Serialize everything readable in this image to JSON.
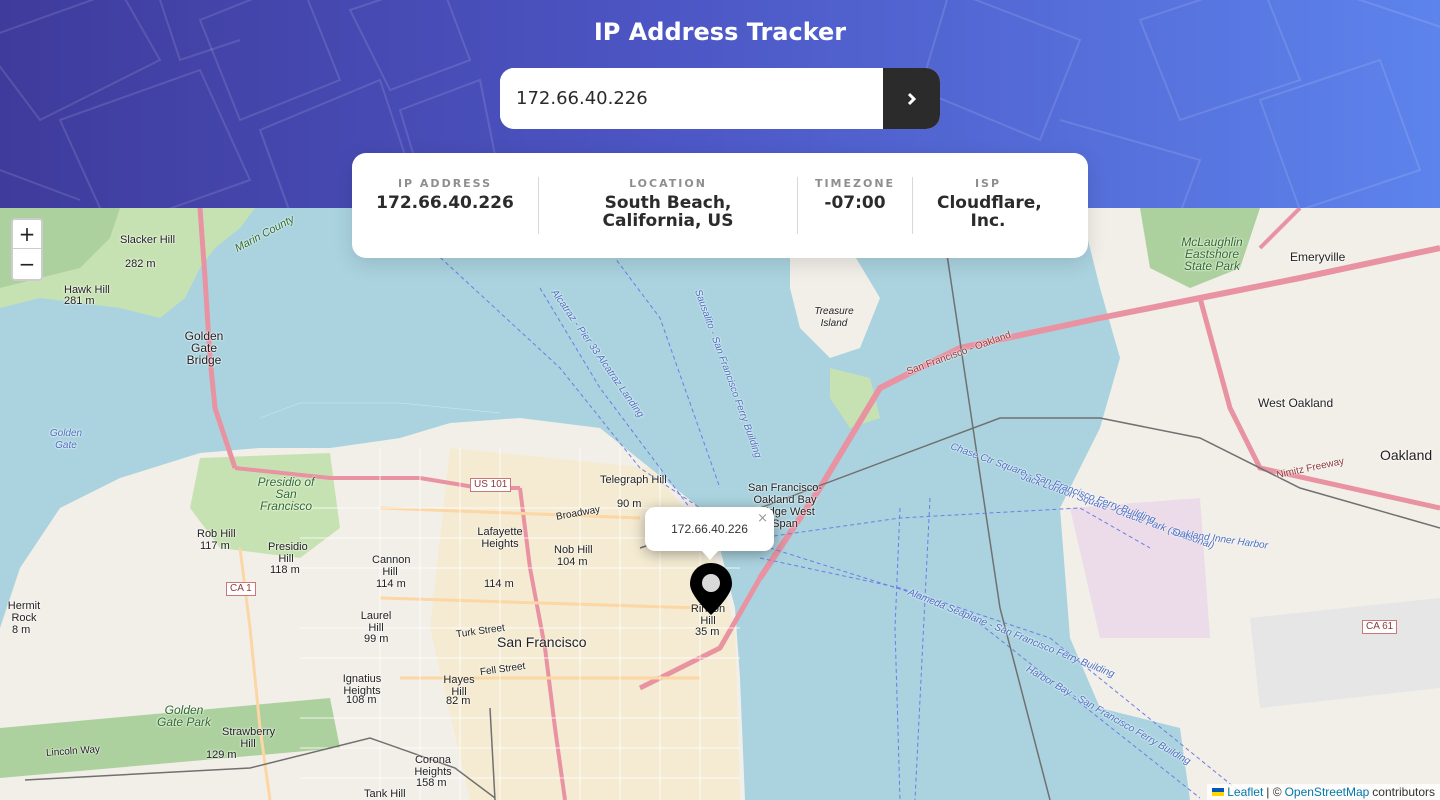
{
  "header": {
    "title": "IP Address Tracker",
    "search_value": "172.66.40.226",
    "search_button_icon": "chevron-right-icon"
  },
  "info": {
    "ip": {
      "label": "IP ADDRESS",
      "value": "172.66.40.226"
    },
    "location": {
      "label": "LOCATION",
      "value": "South Beach, California, US"
    },
    "timezone": {
      "label": "TIMEZONE",
      "value": "-07:00"
    },
    "isp": {
      "label": "ISP",
      "value": "Cloudflare, Inc."
    }
  },
  "map": {
    "zoom_in": "+",
    "zoom_out": "−",
    "popup_text": "172.66.40.226",
    "popup_close": "×",
    "attribution": {
      "leaflet": "Leaflet",
      "sep": "| ©",
      "osm": "OpenStreetMap",
      "suffix": "contributors"
    },
    "labels": {
      "marin_county": "Marin County",
      "slacker_hill": "Slacker Hill",
      "slacker_elev": "282 m",
      "hawk_hill": "Hawk Hill",
      "hawk_elev": "281 m",
      "golden_gate_bridge": "Golden Gate Bridge",
      "golden_gate": "Golden Gate",
      "presidio": "Presidio of San Francisco",
      "mclaughlin": "McLaughlin Eastshore State Park",
      "emeryville": "Emeryville",
      "treasure_island": "Treasure Island",
      "west_oakland": "West Oakland",
      "oakland": "Oakland",
      "telegraph_hill": "Telegraph Hill",
      "telegraph_elev": "90 m",
      "nob_hill": "Nob Hill",
      "nob_elev": "104 m",
      "lafayette": "Lafayette Heights",
      "lafayette_elev": "114 m",
      "cannon_hill": "Cannon Hill",
      "cannon_elev": "114 m",
      "presidio_hill": "Presidio Hill",
      "presidio_elev": "118 m",
      "rob_hill": "Rob Hill",
      "rob_elev": "117 m",
      "laurel_hill": "Laurel Hill",
      "laurel_elev": "99 m",
      "san_francisco": "San Francisco",
      "hayes_hill": "Hayes Hill",
      "hayes_elev": "82 m",
      "ignatius": "Ignatius Heights",
      "ignatius_elev": "108 m",
      "golden_gate_park": "Golden Gate Park",
      "strawberry": "Strawberry Hill",
      "strawberry_elev": "129 m",
      "corona": "Corona Heights",
      "corona_elev": "158 m",
      "tank_hill": "Tank Hill",
      "hermit_rock": "Hermit Rock",
      "hermit_elev": "8 m",
      "rincon": "Rincon Hill",
      "rincon_elev": "35 m",
      "bay_bridge": "San Francisco-Oakland Bay Bridge West Span",
      "us101": "US 101",
      "ca1": "CA 1",
      "ca61": "CA 61",
      "broadway": "Broadway",
      "turk": "Turk Street",
      "fell": "Fell Street",
      "lincoln": "Lincoln Way",
      "nimitz": "Nimitz Freeway",
      "sf_oakland_route": "San Francisco - Oakland",
      "ferry1": "Jack London Square - Oracle Park (Seasonal)",
      "ferry2": "Chase Ctr Square - San Francisco Ferry Building",
      "ferry3": "Oakland Inner Harbor",
      "ferry4": "Alameda Seaplane - San Francisco Ferry Building",
      "ferry5": "Harbor Bay - San Francisco Ferry Building",
      "ferry6": "Sausalito - San Francisco Ferry Building",
      "ferry7": "Alcatraz - Pier 33 Alcatraz Landing"
    }
  }
}
